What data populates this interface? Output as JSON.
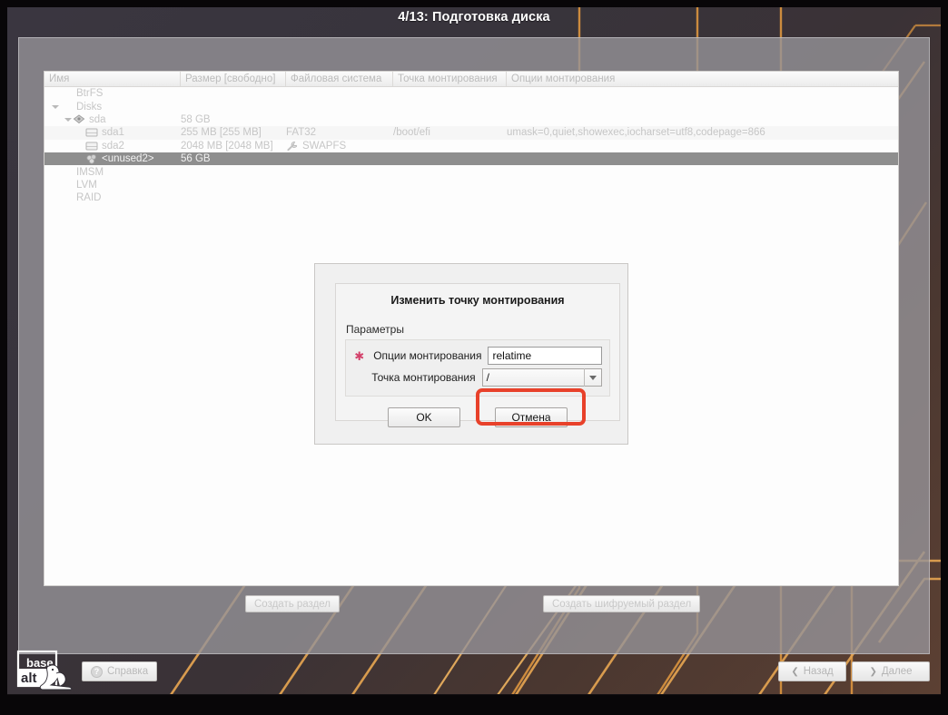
{
  "window": {
    "title": "4/13: Подготовка диска"
  },
  "table": {
    "columns": [
      {
        "label": "Имя"
      },
      {
        "label": "Размер [свободно]"
      },
      {
        "label": "Файловая система"
      },
      {
        "label": "Точка монтирования"
      },
      {
        "label": "Опции монтирования"
      }
    ],
    "rows": [
      {
        "name": "BtrFS",
        "size": "",
        "fs": "",
        "mount": "",
        "opts": "",
        "depth": 1,
        "icon": "none",
        "twisty": "",
        "selected": false
      },
      {
        "name": "Disks",
        "size": "",
        "fs": "",
        "mount": "",
        "opts": "",
        "depth": 1,
        "icon": "none",
        "twisty": "open",
        "selected": false
      },
      {
        "name": "sda",
        "size": "58 GB",
        "fs": "",
        "mount": "",
        "opts": "",
        "depth": 2,
        "icon": "disk-icon",
        "twisty": "open",
        "selected": false
      },
      {
        "name": "sda1",
        "size": "255 MB [255 MB]",
        "fs": "FAT32",
        "mount": "/boot/efi",
        "opts": "umask=0,quiet,showexec,iocharset=utf8,codepage=866",
        "depth": 3,
        "icon": "partition-icon",
        "twisty": "",
        "selected": false
      },
      {
        "name": "sda2",
        "size": "2048 MB [2048 MB]",
        "fs": "SWAPFS",
        "mount": "",
        "opts": "",
        "depth": 3,
        "icon": "partition-icon",
        "fsicon": "wrench-icon",
        "twisty": "",
        "selected": false
      },
      {
        "name": "<unused2>",
        "size": "56 GB",
        "fs": "",
        "mount": "",
        "opts": "",
        "depth": 3,
        "icon": "unused-icon",
        "twisty": "",
        "selected": true
      },
      {
        "name": "IMSM",
        "size": "",
        "fs": "",
        "mount": "",
        "opts": "",
        "depth": 1,
        "icon": "none",
        "twisty": "",
        "selected": false
      },
      {
        "name": "LVM",
        "size": "",
        "fs": "",
        "mount": "",
        "opts": "",
        "depth": 1,
        "icon": "none",
        "twisty": "",
        "selected": false
      },
      {
        "name": "RAID",
        "size": "",
        "fs": "",
        "mount": "",
        "opts": "",
        "depth": 1,
        "icon": "none",
        "twisty": "",
        "selected": false
      }
    ]
  },
  "actions": {
    "create_partition": "Создать раздел",
    "create_encrypted": "Создать шифруемый раздел"
  },
  "footer": {
    "help": "Справка",
    "back": "Назад",
    "next": "Далее",
    "back_chevron": "❮",
    "next_chevron": "❯",
    "help_icon_glyph": "?",
    "logo_line1": "base",
    "logo_line2": "alt"
  },
  "dialog": {
    "title": "Изменить точку монтирования",
    "group_label": "Параметры",
    "required_marker": "✱",
    "fields": [
      {
        "label": "Опции монтирования",
        "value": "relatime",
        "type": "text",
        "required": true
      },
      {
        "label": "Точка монтирования",
        "value": "/",
        "type": "combo",
        "required": false
      }
    ],
    "ok": "OK",
    "cancel": "Отмена"
  },
  "colors": {
    "accent_orange": "#e3a04a",
    "highlight_red": "#e8412a",
    "selection_grey": "#8e8e8e",
    "required_star": "#d3426b"
  }
}
